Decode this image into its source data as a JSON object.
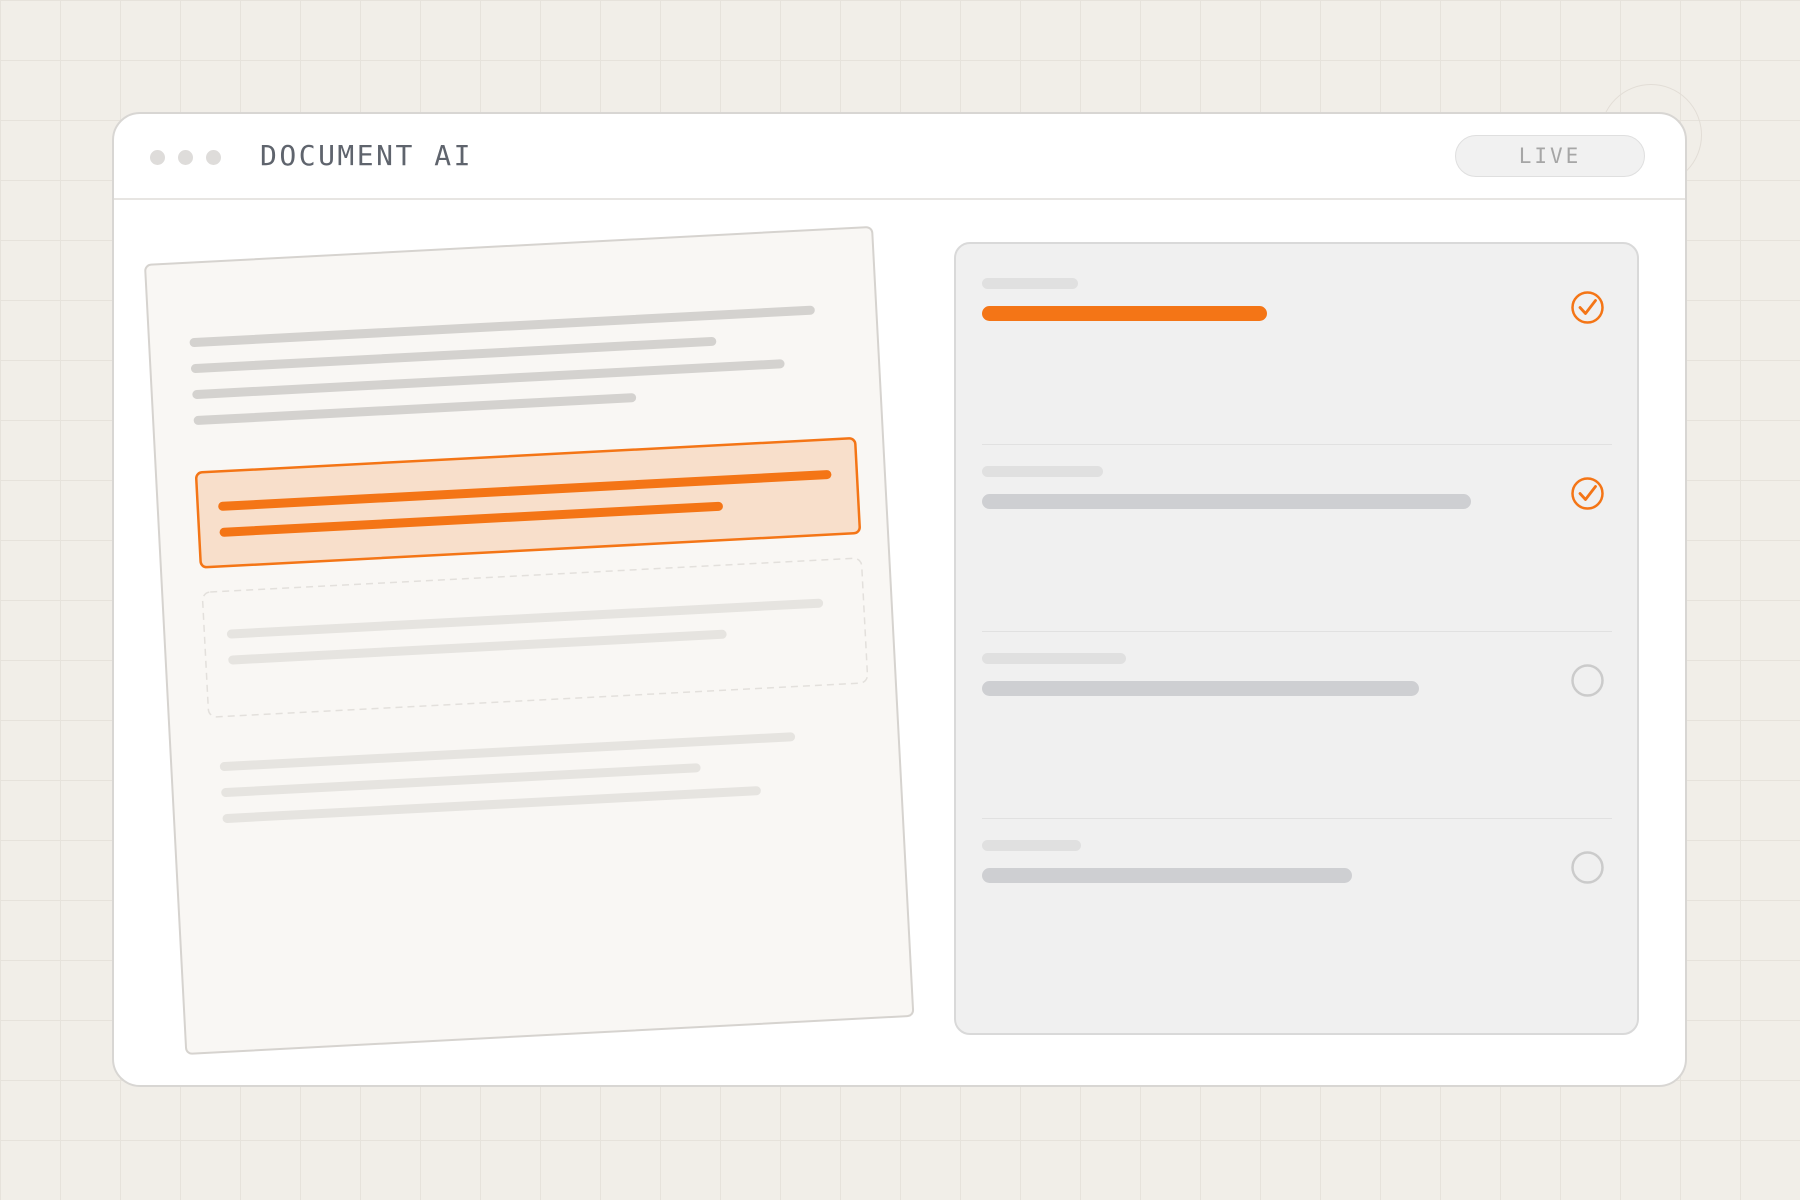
{
  "window": {
    "title": "DOCUMENT AI",
    "status_badge": "LIVE"
  },
  "colors": {
    "accent": "#f47516",
    "highlight_fill": "#f8dfcb",
    "background": "#f1eee8",
    "placeholder_line": "#d4d2cf"
  },
  "document": {
    "highlighted_region": "extracted",
    "candidate_region": "pending"
  },
  "extraction_panel": {
    "fields": [
      {
        "status": "done",
        "icon": "check-circle-icon",
        "active": true
      },
      {
        "status": "done",
        "icon": "check-circle-icon",
        "active": false
      },
      {
        "status": "pending",
        "icon": "empty-circle-icon",
        "active": false
      },
      {
        "status": "pending",
        "icon": "empty-circle-icon",
        "active": false
      }
    ]
  }
}
